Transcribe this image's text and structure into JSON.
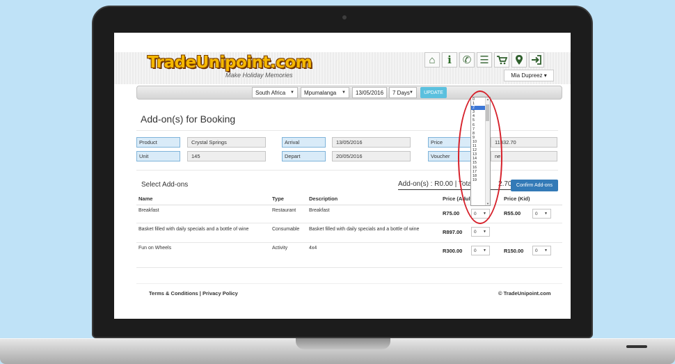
{
  "site": {
    "logo_text": "TradeUnipoint.com",
    "tagline": "Make Holiday Memories",
    "user_name": "Mia Dupreez ▾"
  },
  "nav_icons": [
    "home-icon",
    "info-icon",
    "phone-icon",
    "menu-icon",
    "cart-icon",
    "location-icon",
    "login-icon"
  ],
  "toolbar": {
    "country": "South Africa",
    "region": "Mpumalanga",
    "date": "13/05/2016",
    "duration": "7 Days",
    "update_label": "UPDATE"
  },
  "page_title": "Add-on(s) for Booking",
  "booking": {
    "product_label": "Product",
    "product_value": "Crystal Springs",
    "unit_label": "Unit",
    "unit_value": "145",
    "arrival_label": "Arrival",
    "arrival_value": "13/05/2016",
    "depart_label": "Depart",
    "depart_value": "20/05/2016",
    "price_label": "Price",
    "price_value": "11332.70",
    "voucher_label": "Voucher",
    "voucher_value": "ne"
  },
  "addons": {
    "section_label": "Select Add-ons",
    "totals_text": "Add-on(s) : R0.00 | Total",
    "totals_tail": "2.70",
    "confirm_label": "Confirm Add-ons",
    "columns": {
      "name": "Name",
      "type": "Type",
      "description": "Description",
      "price_adult": "Price (Adult",
      "price_kid": "Price (Kid)"
    },
    "rows": [
      {
        "name": "Breakfast",
        "type": "Restaurant",
        "description": "Breakfast",
        "price_adult": "R75.00",
        "qty_adult": "0",
        "price_kid": "R55.00",
        "qty_kid": "0"
      },
      {
        "name": "Basket filled with daily specials and a bottle of wine",
        "type": "Consumable",
        "description": "Basket filled with daily specials and a bottle of wine",
        "price_adult": "R897.00",
        "qty_adult": "0",
        "price_kid": "",
        "qty_kid": ""
      },
      {
        "name": "Fun on Wheels",
        "type": "Activity",
        "description": "4x4",
        "price_adult": "R300.00",
        "qty_adult": "0",
        "price_kid": "R150.00",
        "qty_kid": "0"
      }
    ]
  },
  "dropdown": {
    "options": [
      "0",
      "1",
      "2",
      "3",
      "4",
      "5",
      "6",
      "7",
      "8",
      "9",
      "10",
      "11",
      "12",
      "13",
      "14",
      "15",
      "16",
      "17",
      "18",
      "19"
    ],
    "selected_index": 2
  },
  "footer": {
    "left": "Terms & Conditions | Privacy Policy",
    "right": "© TradeUnipoint.com"
  },
  "colors": {
    "accent_update": "#5bc0de",
    "confirm_button": "#337ab7",
    "label_bg": "#d9ebf8",
    "highlight": "#d6202a",
    "logo": "#f5b800"
  }
}
